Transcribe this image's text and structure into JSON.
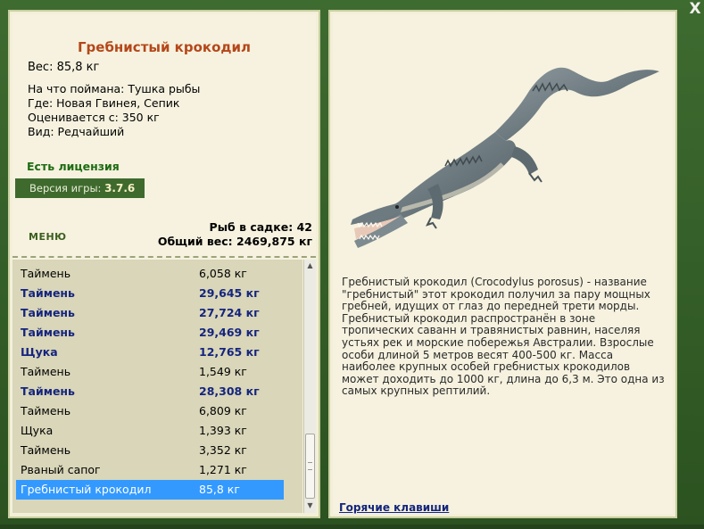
{
  "close_glyph": "X",
  "left": {
    "fish_name": "Гребнистый крокодил",
    "weight_line": "Вес: 85,8 кг",
    "details": [
      "На что поймана: Тушка рыбы",
      "Где: Новая Гвинея, Сепик",
      "Оценивается с: 350 кг",
      "Вид: Редчайший"
    ],
    "license": "Есть лицензия",
    "version_label": "Версия игры:",
    "version_value": "3.7.6",
    "menu_label": "МЕНЮ",
    "cage_count": "Рыб в садке: 42",
    "total_weight": "Общий вес: 2469,875 кг"
  },
  "catches": [
    {
      "name": "Таймень",
      "weight": "6,058 кг",
      "big": false
    },
    {
      "name": "Таймень",
      "weight": "29,645 кг",
      "big": true
    },
    {
      "name": "Таймень",
      "weight": "27,724 кг",
      "big": true
    },
    {
      "name": "Таймень",
      "weight": "29,469 кг",
      "big": true
    },
    {
      "name": "Щука",
      "weight": "12,765 кг",
      "big": true
    },
    {
      "name": "Таймень",
      "weight": "1,549 кг",
      "big": false
    },
    {
      "name": "Таймень",
      "weight": "28,308 кг",
      "big": true
    },
    {
      "name": "Таймень",
      "weight": "6,809 кг",
      "big": false
    },
    {
      "name": "Щука",
      "weight": "1,393 кг",
      "big": false
    },
    {
      "name": "Таймень",
      "weight": "3,352 кг",
      "big": false
    },
    {
      "name": "Рваный сапог",
      "weight": "1,271 кг",
      "big": false
    },
    {
      "name": "Гребнистый крокодил",
      "weight": "85,8 кг",
      "big": false,
      "selected": true
    }
  ],
  "right": {
    "description": "Гребнистый крокодил (Crocodylus porosus) - название \"гребнистый\" этот крокодил получил за пару мощных гребней, идущих от глаз до передней трети морды. Гребнистый крокодил распространён в зоне тропических саванн и травянистых равнин, населяя устьях рек и морские побережья Австралии. Взрослые особи длиной 5 метров весят 400-500 кг. Масса наиболее крупных особей гребнистых крокодилов может доходить до 1000 кг, длина до 6,3 м. Это одна из самых крупных рептилий.",
    "hotkeys": "Горячие клавиши"
  },
  "colors": {
    "title": "#b5471a",
    "license": "#1e6b12",
    "big_catch": "#15257e",
    "selection": "#3399ff"
  },
  "icons": {
    "close": "close-icon",
    "scroll_up": "scroll-up-arrow-icon",
    "scroll_down": "scroll-down-arrow-icon"
  }
}
